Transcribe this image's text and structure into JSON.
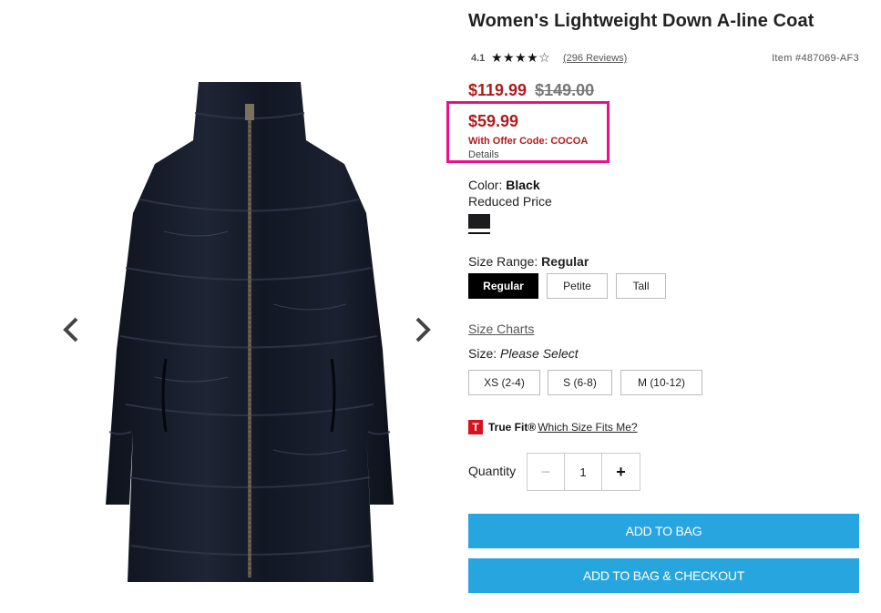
{
  "product": {
    "title": "Women's Lightweight Down A-line Coat",
    "rating": "4.1",
    "stars_filled": 4,
    "stars_total": 5,
    "reviews_text": "(296 Reviews)",
    "item_number": "Item #487069-AF3"
  },
  "pricing": {
    "sale_price": "$119.99",
    "original_price": "$149.00",
    "offer_price": "$59.99",
    "offer_code_text": "With Offer Code: COCOA",
    "details_link": "Details",
    "highlight_color": "#ec0f8b",
    "price_color": "#b01c1c"
  },
  "color": {
    "label": "Color:",
    "value": "Black",
    "note": "Reduced Price",
    "swatch_hex": "#1c1c1e"
  },
  "size_range": {
    "label": "Size Range:",
    "value": "Regular",
    "options": [
      "Regular",
      "Petite",
      "Tall"
    ]
  },
  "size": {
    "charts_link": "Size Charts",
    "label": "Size:",
    "placeholder": "Please Select",
    "options": [
      "XS (2-4)",
      "S (6-8)",
      "M (10-12)"
    ]
  },
  "true_fit": {
    "icon": "T",
    "brand": "True Fit®",
    "link": "Which Size Fits Me?"
  },
  "quantity": {
    "label": "Quantity",
    "value": "1",
    "minus": "−",
    "plus": "+"
  },
  "actions": {
    "add_to_bag": "ADD TO BAG",
    "add_to_bag_checkout": "ADD TO BAG & CHECKOUT",
    "button_color": "#27a5df"
  },
  "gallery": {
    "prev_icon": "chevron-left-icon",
    "next_icon": "chevron-right-icon"
  }
}
